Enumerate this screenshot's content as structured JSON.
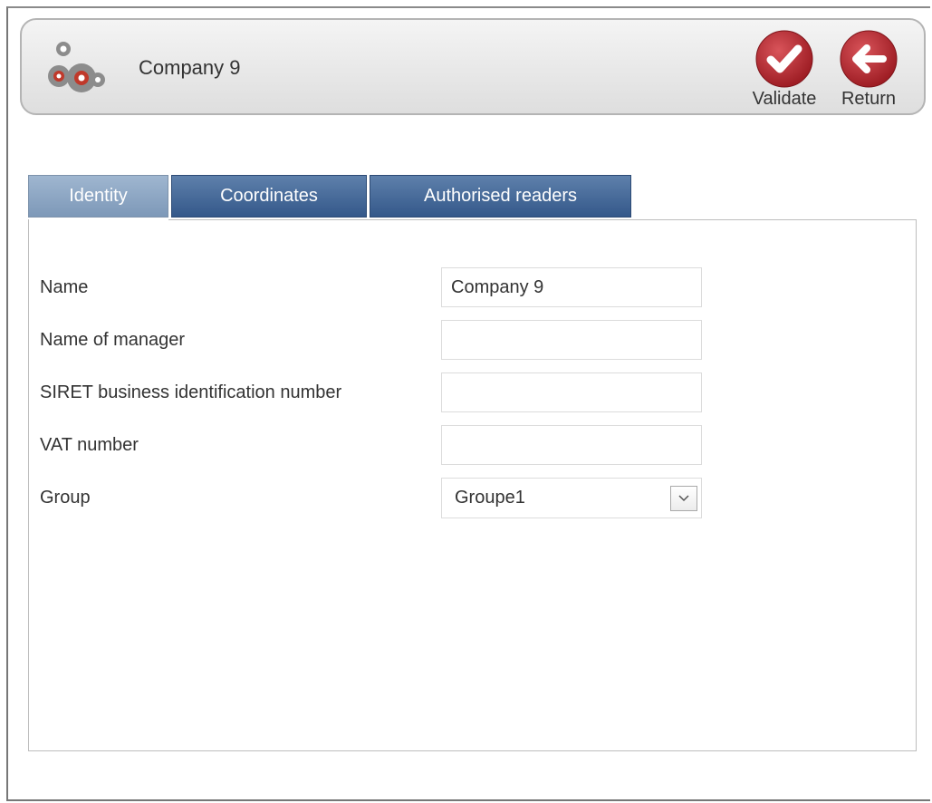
{
  "header": {
    "title": "Company 9",
    "app_icon": "gears-icon",
    "validate_label": "Validate",
    "return_label": "Return"
  },
  "tabs": [
    {
      "label": "Identity",
      "active": true
    },
    {
      "label": "Coordinates",
      "active": false
    },
    {
      "label": "Authorised readers",
      "active": false
    }
  ],
  "form": {
    "name": {
      "label": "Name",
      "value": "Company 9"
    },
    "manager": {
      "label": "Name of manager",
      "value": ""
    },
    "siret": {
      "label": "SIRET business identification number",
      "value": ""
    },
    "vat": {
      "label": "VAT number",
      "value": ""
    },
    "group": {
      "label": "Group",
      "value": "Groupe1"
    }
  },
  "colors": {
    "button_red": "#b5282e",
    "tab_blue": "#3f6394",
    "tab_active": "#8aa4c2"
  }
}
